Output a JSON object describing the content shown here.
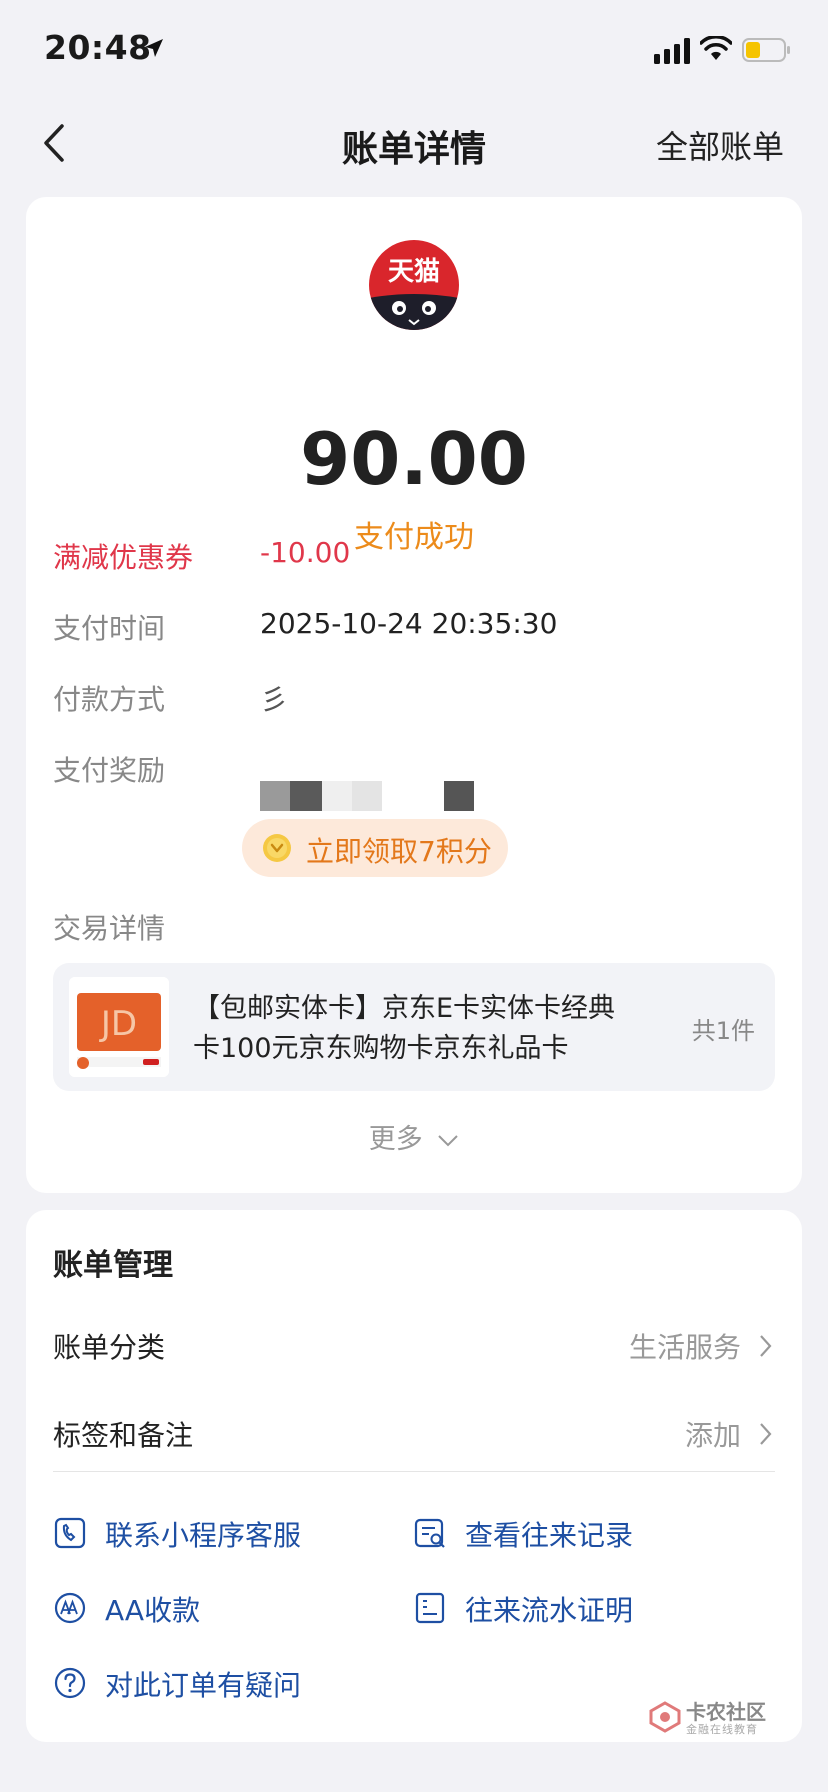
{
  "status_bar": {
    "time": "20:48"
  },
  "nav": {
    "title": "账单详情",
    "right_link": "全部账单"
  },
  "bill": {
    "merchant_logo_text": "天猫",
    "merchant_name": "-- -- ---",
    "amount": "90.00",
    "status": "支付成功",
    "discount_label": "满减优惠券",
    "discount_value": "-10.00",
    "time_label": "支付时间",
    "time_value": "2025-10-24 20:35:30",
    "method_label": "付款方式",
    "method_value_visible": "彡",
    "reward_label": "支付奖励",
    "reward_value": "立即领取7积分",
    "detail_label": "交易详情",
    "item_title": "【包邮实体卡】京东E卡实体卡经典卡100元京东购物卡京东礼品卡",
    "item_count": "共1件",
    "item_thumb_text": "JD",
    "more": "更多"
  },
  "manage": {
    "title": "账单管理",
    "category_label": "账单分类",
    "category_value": "生活服务",
    "tags_label": "标签和备注",
    "tags_value": "添加",
    "actions": [
      {
        "label": "联系小程序客服",
        "icon": "phone-icon"
      },
      {
        "label": "查看往来记录",
        "icon": "record-search-icon"
      },
      {
        "label": "AA收款",
        "icon": "aa-icon"
      },
      {
        "label": "往来流水证明",
        "icon": "document-icon"
      },
      {
        "label": "对此订单有疑问",
        "icon": "question-icon"
      }
    ]
  },
  "watermark": {
    "title": "卡农社区",
    "subtitle": "金融在线教育"
  },
  "colors": {
    "accent_orange": "#ec8b1b",
    "discount_red": "#e0374a",
    "link_blue": "#1e4fa3",
    "tmall_red": "#d9262c"
  }
}
